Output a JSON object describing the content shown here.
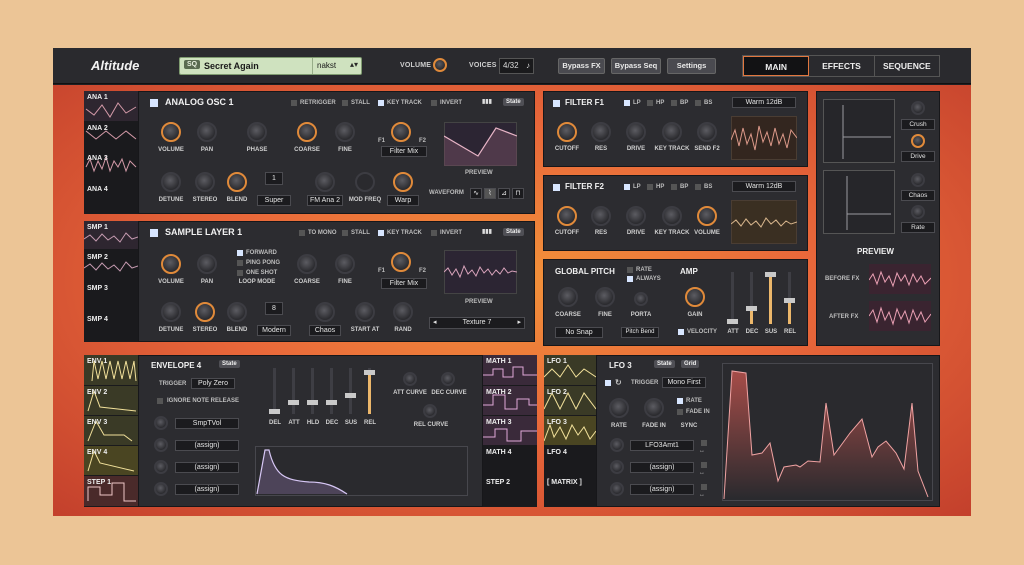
{
  "app": {
    "title": "Altitude"
  },
  "preset": {
    "tag": "SQ",
    "name": "Secret Again",
    "author": "nakst",
    "arrows": "▴▾"
  },
  "header": {
    "volume_label": "VOLUME",
    "voices_label": "VOICES",
    "voices_value": "4/32",
    "voices_icon": "♪",
    "bypass_fx": "Bypass FX",
    "bypass_seq": "Bypass Seq",
    "settings": "Settings"
  },
  "tabs": [
    {
      "label": "MAIN"
    },
    {
      "label": "EFFECTS"
    },
    {
      "label": "SEQUENCE"
    }
  ],
  "osc_tabs": [
    "ANA 1",
    "ANA 2",
    "ANA 3",
    "ANA 4"
  ],
  "osc": {
    "title": "ANALOG OSC 1",
    "retrigger": "RETRIGGER",
    "stall": "STALL",
    "key_track": "KEY TRACK",
    "invert": "INVERT",
    "state": "State",
    "k_volume": "VOLUME",
    "k_pan": "PAN",
    "k_phase": "PHASE",
    "k_coarse": "COARSE",
    "k_fine": "FINE",
    "f1": "F1",
    "f2": "F2",
    "filter_mix": "Filter Mix",
    "k_detune": "DETUNE",
    "k_stereo": "STEREO",
    "k_blend": "BLEND",
    "unison": "1",
    "mode": "Super",
    "fm_src": "FM Ana 2",
    "k_modfreq": "MOD FREQ",
    "warp": "Warp",
    "preview": "PREVIEW",
    "waveform": "WAVEFORM"
  },
  "smp_tabs": [
    "SMP 1",
    "SMP 2",
    "SMP 3",
    "SMP 4"
  ],
  "smp": {
    "title": "SAMPLE LAYER 1",
    "to_mono": "TO MONO",
    "stall": "STALL",
    "key_track": "KEY TRACK",
    "invert": "INVERT",
    "state": "State",
    "k_volume": "VOLUME",
    "k_pan": "PAN",
    "forward": "FORWARD",
    "ping_pong": "PING PONG",
    "one_shot": "ONE SHOT",
    "loop_mode": "LOOP MODE",
    "k_coarse": "COARSE",
    "k_fine": "FINE",
    "f1": "F1",
    "f2": "F2",
    "filter_mix": "Filter Mix",
    "k_detune": "DETUNE",
    "k_stereo": "STEREO",
    "k_blend": "BLEND",
    "voices": "8",
    "mode": "Modern",
    "chaos": "Chaos",
    "k_start": "START AT",
    "k_rand": "RAND",
    "preview": "PREVIEW",
    "texture": "Texture 7",
    "prev": "◂",
    "next": "▸"
  },
  "filter1": {
    "title": "FILTER F1",
    "lp": "LP",
    "hp": "HP",
    "bp": "BP",
    "bs": "BS",
    "type": "Warm 12dB",
    "k1": "CUTOFF",
    "k2": "RES",
    "k3": "DRIVE",
    "k4": "KEY TRACK",
    "k5": "SEND F2"
  },
  "filter2": {
    "title": "FILTER F2",
    "lp": "LP",
    "hp": "HP",
    "bp": "BP",
    "bs": "BS",
    "type": "Warm 12dB",
    "k1": "CUTOFF",
    "k2": "RES",
    "k3": "DRIVE",
    "k4": "KEY TRACK",
    "k5": "VOLUME"
  },
  "pitch": {
    "title": "GLOBAL PITCH",
    "rate": "RATE",
    "always": "ALWAYS",
    "k_coarse": "COARSE",
    "k_fine": "FINE",
    "k_porta": "PORTA",
    "no_snap": "No Snap",
    "pitch_bend": "Pitch Bend"
  },
  "amp": {
    "title": "AMP",
    "k_gain": "GAIN",
    "velocity": "VELOCITY",
    "att": "ATT",
    "dec": "DEC",
    "sus": "SUS",
    "rel": "REL",
    "levels": [
      0.05,
      0.3,
      1.0,
      0.45
    ]
  },
  "fx": {
    "crush": "Crush",
    "drive": "Drive",
    "chaos": "Chaos",
    "rate": "Rate",
    "preview": "PREVIEW",
    "before": "BEFORE FX",
    "after": "AFTER FX"
  },
  "env_tabs": [
    "ENV 1",
    "ENV 2",
    "ENV 3",
    "ENV 4",
    "STEP 1"
  ],
  "env": {
    "title": "ENVELOPE 4",
    "state": "State",
    "trigger_label": "TRIGGER",
    "trigger": "Poly Zero",
    "ignore": "IGNORE NOTE RELEASE",
    "assign1": "SmpTVol",
    "assign2": "(assign)",
    "assign3": "(assign)",
    "assign4": "(assign)",
    "del": "DEL",
    "att": "ATT",
    "hld": "HLD",
    "dec": "DEC",
    "sus": "SUS",
    "rel": "REL",
    "levels": [
      0.05,
      0.25,
      0.25,
      0.25,
      0.4,
      0.9
    ],
    "att_curve": "ATT CURVE",
    "dec_curve": "DEC CURVE",
    "rel_curve": "REL CURVE"
  },
  "math_tabs": [
    "MATH 1",
    "MATH 2",
    "MATH 3",
    "MATH 4",
    "STEP 2"
  ],
  "lfo_tabs": [
    "LFO 1",
    "LFO 2",
    "LFO 3",
    "LFO 4",
    "[ MATRIX ]"
  ],
  "lfo": {
    "title": "LFO 3",
    "state": "State",
    "grid": "Grid",
    "trigger_label": "TRIGGER",
    "trigger": "Mono First",
    "rate": "RATE",
    "fade_in": "FADE IN",
    "k_rate": "RATE",
    "k_fade": "FADE IN",
    "k_sync": "SYNC",
    "assign1": "LFO3Amt1",
    "assign2": "(assign)",
    "assign3": "(assign)"
  }
}
